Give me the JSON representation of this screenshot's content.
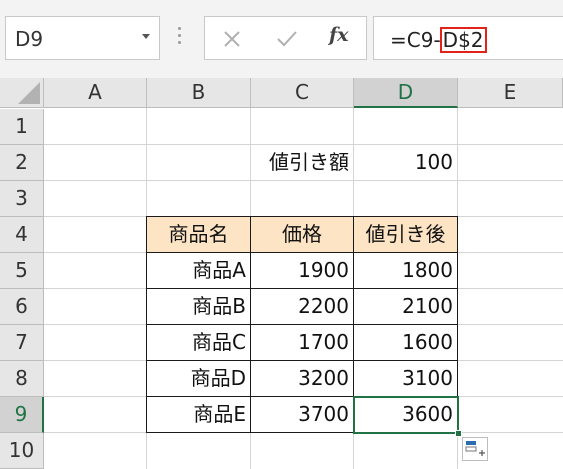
{
  "formula_bar": {
    "name_box": "D9",
    "formula_prefix": "=C9-",
    "formula_ref": "D$2",
    "cancel_icon": "close-icon",
    "enter_icon": "check-icon",
    "insert_function_label": "fx"
  },
  "columns": [
    "A",
    "B",
    "C",
    "D",
    "E"
  ],
  "rows": [
    "1",
    "2",
    "3",
    "4",
    "5",
    "6",
    "7",
    "8",
    "9",
    "10"
  ],
  "selected": {
    "column": "D",
    "row": "9"
  },
  "cells": {
    "c2": "値引き額",
    "d2": "100",
    "table_headers": [
      "商品名",
      "価格",
      "値引き後"
    ],
    "table_rows": [
      [
        "商品A",
        "1900",
        "1800"
      ],
      [
        "商品B",
        "2200",
        "2100"
      ],
      [
        "商品C",
        "1700",
        "1600"
      ],
      [
        "商品D",
        "3200",
        "3100"
      ],
      [
        "商品E",
        "3700",
        "3600"
      ]
    ]
  },
  "colors": {
    "header_fill": "#fce4c4",
    "selection": "#217346",
    "reference_highlight": "#e2231a"
  }
}
